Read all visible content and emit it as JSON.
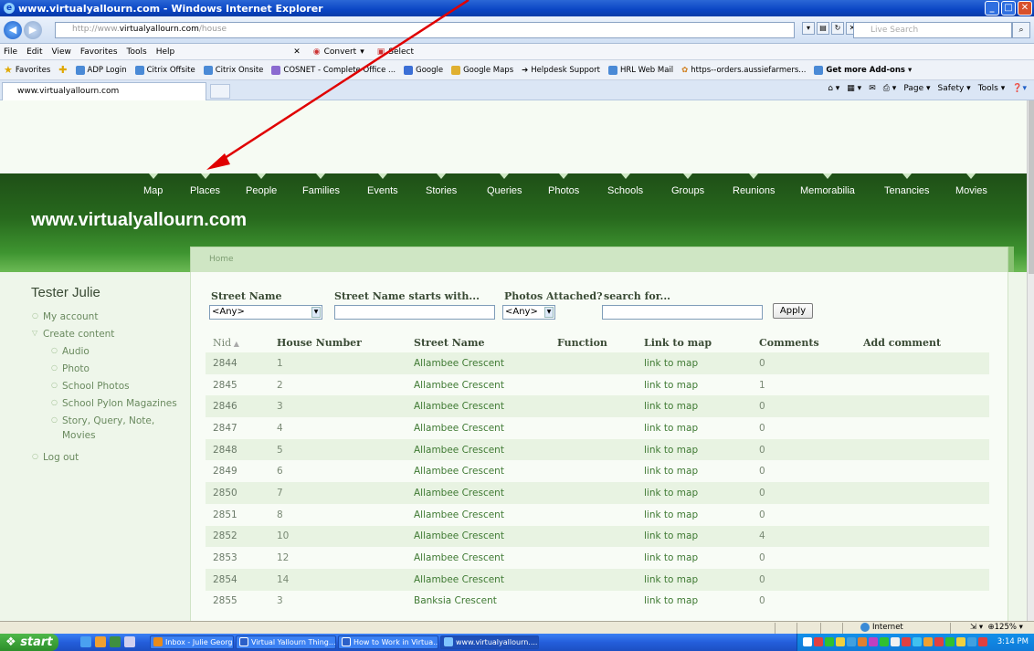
{
  "window": {
    "title": "www.virtualyallourn.com - Windows Internet Explorer"
  },
  "address": {
    "url_lead": "http://www.",
    "url_host": "virtualyallourn.com",
    "url_tail": "/house",
    "search_placeholder": "Live Search"
  },
  "menu": {
    "items": [
      "File",
      "Edit",
      "View",
      "Favorites",
      "Tools",
      "Help"
    ],
    "convert": "Convert",
    "select": "Select"
  },
  "favorites": {
    "label": "Favorites",
    "links": [
      "ADP Login",
      "Citrix Offsite",
      "Citrix Onsite",
      "COSNET - Complete Office ...",
      "Google",
      "Google Maps",
      "Helpdesk Support",
      "HRL Web Mail",
      "https--orders.aussiefarmers..."
    ],
    "addons": "Get more Add-ons"
  },
  "tab": {
    "title": "www.virtualyallourn.com"
  },
  "commandbar": {
    "page": "Page",
    "safety": "Safety",
    "tools": "Tools"
  },
  "site": {
    "name": "www.virtualyallourn.com",
    "nav": [
      "Map",
      "Places",
      "People",
      "Families",
      "Events",
      "Stories",
      "Queries",
      "Photos",
      "Schools",
      "Groups",
      "Reunions",
      "Memorabilia",
      "Tenancies",
      "Movies"
    ],
    "breadcrumb": "Home"
  },
  "sidebar": {
    "user": "Tester Julie",
    "my_account": "My account",
    "create_content": "Create content",
    "children": [
      "Audio",
      "Photo",
      "School Photos",
      "School Pylon Magazines",
      "Story, Query, Note,",
      "Movies"
    ],
    "logout": "Log out"
  },
  "filters": {
    "street_name": {
      "label": "Street Name",
      "value": "<Any>"
    },
    "starts_with": {
      "label": "Street Name starts with..."
    },
    "photos": {
      "label": "Photos Attached?",
      "value": "<Any>"
    },
    "search": {
      "label": "search for..."
    },
    "apply": "Apply"
  },
  "table": {
    "headers": {
      "nid": "Nid",
      "house": "House Number",
      "street": "Street Name",
      "function": "Function",
      "link": "Link to map",
      "comments": "Comments",
      "add": "Add comment"
    },
    "rows": [
      {
        "nid": "2844",
        "house": "1",
        "street": "Allambee Crescent",
        "link": "link to map",
        "comments": "0"
      },
      {
        "nid": "2845",
        "house": "2",
        "street": "Allambee Crescent",
        "link": "link to map",
        "comments": "1"
      },
      {
        "nid": "2846",
        "house": "3",
        "street": "Allambee Crescent",
        "link": "link to map",
        "comments": "0"
      },
      {
        "nid": "2847",
        "house": "4",
        "street": "Allambee Crescent",
        "link": "link to map",
        "comments": "0"
      },
      {
        "nid": "2848",
        "house": "5",
        "street": "Allambee Crescent",
        "link": "link to map",
        "comments": "0"
      },
      {
        "nid": "2849",
        "house": "6",
        "street": "Allambee Crescent",
        "link": "link to map",
        "comments": "0"
      },
      {
        "nid": "2850",
        "house": "7",
        "street": "Allambee Crescent",
        "link": "link to map",
        "comments": "0"
      },
      {
        "nid": "2851",
        "house": "8",
        "street": "Allambee Crescent",
        "link": "link to map",
        "comments": "0"
      },
      {
        "nid": "2852",
        "house": "10",
        "street": "Allambee Crescent",
        "link": "link to map",
        "comments": "4"
      },
      {
        "nid": "2853",
        "house": "12",
        "street": "Allambee Crescent",
        "link": "link to map",
        "comments": "0"
      },
      {
        "nid": "2854",
        "house": "14",
        "street": "Allambee Crescent",
        "link": "link to map",
        "comments": "0"
      },
      {
        "nid": "2855",
        "house": "3",
        "street": "Banksia Crescent",
        "link": "link to map",
        "comments": "0"
      }
    ]
  },
  "status": {
    "zone": "Internet",
    "zoom": "125%"
  },
  "taskbar": {
    "start": "start",
    "tasks": [
      "Inbox - Julie George -...",
      "Virtual Yallourn Thing...",
      "How to Work in Virtua...",
      "www.virtualyallourn...."
    ],
    "clock": "3:14 PM"
  },
  "colors": {
    "header_dark": "#1f4f17",
    "header_light": "#6cba55",
    "link_green": "#3f7a33",
    "annotation_arrow": "#e00000"
  }
}
